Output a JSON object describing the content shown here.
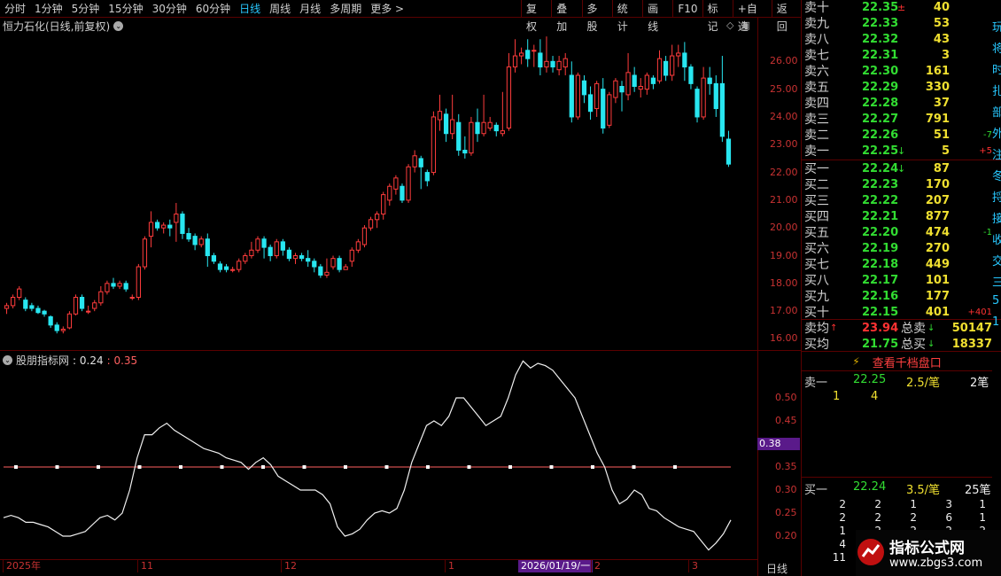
{
  "toolbar": {
    "periods": [
      "分时",
      "1分钟",
      "5分钟",
      "15分钟",
      "30分钟",
      "60分钟",
      "日线",
      "周线",
      "月线",
      "多周期",
      "更多 >"
    ],
    "active": "日线",
    "buttons": [
      "复权",
      "叠加",
      "多股",
      "统计",
      "画线",
      "F10",
      "标记",
      "+自选",
      "返回"
    ]
  },
  "chart_title": "恒力石化(日线,前复权)",
  "price_axis": {
    "ticks": [
      "26.00",
      "25.00",
      "24.00",
      "23.00",
      "22.00",
      "21.00",
      "20.00",
      "19.00",
      "18.00",
      "17.00",
      "16.00"
    ]
  },
  "indicator": {
    "name": "股朋指标网",
    "value1": ": 0.24",
    "value2": ": 0.35",
    "axis": [
      "0.50",
      "0.45",
      "0.40",
      "0.35",
      "0.30",
      "0.25",
      "0.20"
    ],
    "marker": "0.38"
  },
  "date_axis": {
    "ticks": [
      "2025年",
      "11",
      "12",
      "1",
      "2",
      "3"
    ],
    "cursor": "2026/01/19/一",
    "period": "日线"
  },
  "orderbook": {
    "asks": [
      {
        "label": "卖十",
        "price": "22.35",
        "arrow": "±",
        "vol": "40",
        "chg": ""
      },
      {
        "label": "卖九",
        "price": "22.33",
        "arrow": "",
        "vol": "53",
        "chg": ""
      },
      {
        "label": "卖八",
        "price": "22.32",
        "arrow": "",
        "vol": "43",
        "chg": ""
      },
      {
        "label": "卖七",
        "price": "22.31",
        "arrow": "",
        "vol": "3",
        "chg": ""
      },
      {
        "label": "卖六",
        "price": "22.30",
        "arrow": "",
        "vol": "161",
        "chg": ""
      },
      {
        "label": "卖五",
        "price": "22.29",
        "arrow": "",
        "vol": "330",
        "chg": ""
      },
      {
        "label": "卖四",
        "price": "22.28",
        "arrow": "",
        "vol": "37",
        "chg": ""
      },
      {
        "label": "卖三",
        "price": "22.27",
        "arrow": "",
        "vol": "791",
        "chg": ""
      },
      {
        "label": "卖二",
        "price": "22.26",
        "arrow": "",
        "vol": "51",
        "chg": "-7"
      },
      {
        "label": "卖一",
        "price": "22.25",
        "arrow": "↓",
        "vol": "5",
        "chg": "+5"
      }
    ],
    "bids": [
      {
        "label": "买一",
        "price": "22.24",
        "arrow": "↓",
        "vol": "87",
        "chg": ""
      },
      {
        "label": "买二",
        "price": "22.23",
        "arrow": "",
        "vol": "170",
        "chg": ""
      },
      {
        "label": "买三",
        "price": "22.22",
        "arrow": "",
        "vol": "207",
        "chg": ""
      },
      {
        "label": "买四",
        "price": "22.21",
        "arrow": "",
        "vol": "877",
        "chg": ""
      },
      {
        "label": "买五",
        "price": "22.20",
        "arrow": "",
        "vol": "474",
        "chg": "-1"
      },
      {
        "label": "买六",
        "price": "22.19",
        "arrow": "",
        "vol": "270",
        "chg": ""
      },
      {
        "label": "买七",
        "price": "22.18",
        "arrow": "",
        "vol": "449",
        "chg": ""
      },
      {
        "label": "买八",
        "price": "22.17",
        "arrow": "",
        "vol": "101",
        "chg": ""
      },
      {
        "label": "买九",
        "price": "22.16",
        "arrow": "",
        "vol": "177",
        "chg": ""
      },
      {
        "label": "买十",
        "price": "22.15",
        "arrow": "",
        "vol": "401",
        "chg": "+401"
      }
    ],
    "avg_ask": {
      "label": "卖均",
      "price": "23.94",
      "total_label": "总卖",
      "total": "50147"
    },
    "avg_bid": {
      "label": "买均",
      "price": "21.75",
      "total_label": "总买",
      "total": "18337"
    }
  },
  "side_fragments": [
    "玩",
    "将",
    "时",
    "扎",
    "部",
    "外",
    "注",
    "冬",
    "捋",
    "接",
    "收",
    "交",
    "三",
    "5",
    "1"
  ],
  "thousand_link": "查看千档盘口",
  "tick_ask": {
    "label": "卖一",
    "price": "22.25",
    "avg": "2.5/笔",
    "count": "2笔",
    "q1": "1",
    "q2": "4"
  },
  "tick_bid": {
    "label": "买一",
    "price": "22.24",
    "avg": "3.5/笔",
    "count": "25笔"
  },
  "bid_grid": [
    [
      "2",
      "2",
      "1",
      "3",
      "1"
    ],
    [
      "2",
      "2",
      "2",
      "6",
      "1"
    ],
    [
      "1",
      "2",
      "2",
      "2",
      "2"
    ],
    [
      "4",
      "",
      "",
      "",
      ""
    ],
    [
      "11",
      "",
      "",
      "",
      ""
    ]
  ],
  "watermark": {
    "line1": "指标公式网",
    "line2": "www.zbgs3.com"
  },
  "chart_data": {
    "type": "candlestick",
    "ylim": [
      15.6,
      27.0
    ],
    "candles": [
      [
        17.1,
        17.2,
        16.9,
        17.3
      ],
      [
        17.2,
        17.5,
        17.1,
        17.6
      ],
      [
        17.5,
        17.8,
        17.4,
        17.9
      ],
      [
        17.4,
        17.1,
        17.0,
        17.5
      ],
      [
        17.2,
        17.1,
        17.0,
        17.3
      ],
      [
        17.1,
        16.95,
        16.9,
        17.2
      ],
      [
        17.0,
        16.9,
        16.8,
        17.05
      ],
      [
        16.8,
        16.5,
        16.4,
        16.85
      ],
      [
        16.5,
        16.3,
        16.2,
        16.6
      ],
      [
        16.3,
        16.35,
        16.2,
        16.45
      ],
      [
        16.4,
        16.9,
        16.35,
        17.0
      ],
      [
        16.9,
        17.5,
        16.85,
        17.6
      ],
      [
        17.5,
        17.1,
        17.0,
        17.6
      ],
      [
        17.0,
        17.0,
        16.9,
        17.2
      ],
      [
        17.1,
        17.3,
        17.0,
        17.4
      ],
      [
        17.3,
        17.7,
        17.2,
        17.9
      ],
      [
        17.7,
        18.0,
        17.6,
        18.1
      ],
      [
        18.0,
        17.9,
        17.8,
        18.2
      ],
      [
        17.9,
        18.0,
        17.8,
        18.1
      ],
      [
        18.0,
        17.8,
        17.7,
        18.1
      ],
      [
        17.5,
        17.5,
        17.4,
        17.6
      ],
      [
        17.5,
        18.6,
        17.4,
        18.7
      ],
      [
        18.6,
        19.6,
        18.5,
        19.7
      ],
      [
        19.7,
        20.2,
        19.3,
        20.6
      ],
      [
        20.2,
        20.0,
        19.9,
        20.3
      ],
      [
        20.0,
        20.1,
        19.8,
        20.2
      ],
      [
        20.1,
        20.0,
        19.7,
        20.3
      ],
      [
        20.2,
        20.5,
        19.5,
        20.9
      ],
      [
        20.5,
        19.8,
        19.6,
        20.6
      ],
      [
        19.8,
        19.6,
        19.5,
        20.0
      ],
      [
        19.7,
        19.4,
        19.2,
        19.8
      ],
      [
        19.4,
        19.6,
        19.3,
        19.7
      ],
      [
        19.6,
        19.0,
        18.6,
        19.8
      ],
      [
        19.0,
        18.8,
        18.7,
        19.1
      ],
      [
        18.7,
        18.5,
        18.4,
        18.8
      ],
      [
        18.6,
        18.5,
        18.4,
        18.7
      ],
      [
        18.5,
        18.5,
        18.4,
        18.6
      ],
      [
        18.5,
        18.8,
        18.4,
        18.9
      ],
      [
        18.8,
        19.0,
        18.7,
        19.1
      ],
      [
        19.0,
        19.2,
        18.9,
        19.5
      ],
      [
        19.2,
        19.6,
        19.1,
        19.7
      ],
      [
        19.6,
        19.3,
        18.9,
        19.7
      ],
      [
        19.3,
        19.0,
        18.8,
        19.4
      ],
      [
        19.0,
        19.5,
        18.9,
        19.6
      ],
      [
        19.5,
        19.2,
        19.0,
        19.6
      ],
      [
        19.2,
        18.9,
        18.8,
        19.3
      ],
      [
        18.9,
        19.0,
        18.7,
        19.1
      ],
      [
        19.0,
        18.9,
        18.8,
        19.1
      ],
      [
        18.9,
        18.8,
        18.6,
        19.2
      ],
      [
        18.8,
        18.6,
        18.4,
        18.9
      ],
      [
        18.6,
        18.3,
        18.2,
        18.7
      ],
      [
        18.3,
        18.4,
        18.2,
        18.9
      ],
      [
        18.6,
        18.9,
        18.5,
        19.0
      ],
      [
        18.9,
        18.5,
        18.4,
        19.0
      ],
      [
        18.5,
        18.6,
        18.5,
        18.7
      ],
      [
        18.8,
        19.2,
        18.6,
        19.3
      ],
      [
        19.2,
        19.5,
        19.1,
        19.6
      ],
      [
        19.4,
        20.0,
        19.3,
        20.1
      ],
      [
        20.0,
        20.3,
        19.9,
        20.4
      ],
      [
        20.3,
        20.5,
        20.0,
        20.6
      ],
      [
        20.5,
        21.2,
        20.3,
        21.3
      ],
      [
        21.0,
        21.5,
        20.8,
        21.6
      ],
      [
        21.4,
        21.8,
        21.2,
        21.9
      ],
      [
        21.5,
        21.0,
        20.9,
        21.6
      ],
      [
        21.0,
        22.2,
        20.9,
        22.3
      ],
      [
        22.2,
        22.6,
        22.0,
        22.8
      ],
      [
        22.5,
        22.2,
        21.4,
        22.6
      ],
      [
        22.0,
        21.7,
        21.5,
        22.1
      ],
      [
        22.0,
        24.0,
        21.9,
        24.2
      ],
      [
        23.9,
        24.2,
        23.5,
        24.8
      ],
      [
        24.1,
        23.4,
        23.1,
        24.3
      ],
      [
        23.4,
        23.9,
        23.2,
        24.8
      ],
      [
        23.8,
        22.8,
        22.6,
        24.1
      ],
      [
        22.8,
        22.7,
        22.5,
        23.3
      ],
      [
        22.7,
        23.8,
        22.6,
        24.0
      ],
      [
        23.8,
        23.4,
        23.1,
        24.3
      ],
      [
        23.4,
        23.8,
        23.3,
        24.8
      ],
      [
        23.6,
        23.8,
        23.5,
        24.0
      ],
      [
        23.7,
        23.5,
        23.3,
        23.8
      ],
      [
        23.4,
        23.5,
        23.3,
        24.9
      ],
      [
        23.6,
        25.8,
        23.5,
        26.3
      ],
      [
        25.8,
        26.2,
        25.6,
        26.8
      ],
      [
        26.2,
        26.3,
        25.9,
        26.5
      ],
      [
        26.4,
        26.1,
        25.8,
        26.8
      ],
      [
        26.4,
        26.4,
        25.8,
        26.6
      ],
      [
        26.3,
        25.8,
        25.5,
        26.8
      ],
      [
        25.8,
        26.0,
        25.6,
        26.9
      ],
      [
        26.0,
        25.8,
        25.6,
        26.2
      ],
      [
        25.7,
        26.0,
        25.5,
        26.2
      ],
      [
        25.8,
        26.1,
        25.5,
        26.3
      ],
      [
        25.5,
        24.0,
        23.8,
        26.0
      ],
      [
        24.0,
        25.5,
        23.9,
        25.6
      ],
      [
        25.3,
        24.8,
        24.5,
        25.5
      ],
      [
        24.8,
        24.2,
        23.9,
        25.1
      ],
      [
        24.3,
        25.2,
        24.0,
        25.3
      ],
      [
        25.0,
        23.6,
        23.4,
        25.4
      ],
      [
        23.7,
        24.8,
        23.6,
        24.9
      ],
      [
        24.7,
        25.3,
        24.5,
        25.4
      ],
      [
        25.1,
        24.9,
        24.2,
        25.3
      ],
      [
        24.8,
        25.6,
        24.6,
        26.3
      ],
      [
        25.5,
        25.1,
        24.9,
        25.8
      ],
      [
        25.0,
        25.1,
        24.7,
        25.4
      ],
      [
        25.0,
        25.5,
        24.8,
        25.6
      ],
      [
        25.4,
        25.2,
        25.0,
        25.5
      ],
      [
        25.3,
        26.1,
        25.2,
        26.4
      ],
      [
        26.0,
        25.5,
        25.3,
        26.2
      ],
      [
        25.5,
        26.2,
        25.3,
        26.6
      ],
      [
        26.2,
        26.3,
        25.8,
        26.6
      ],
      [
        26.3,
        25.8,
        25.3,
        26.7
      ],
      [
        25.8,
        25.2,
        25.0,
        25.9
      ],
      [
        25.0,
        24.0,
        23.8,
        25.1
      ],
      [
        24.0,
        25.4,
        23.9,
        25.8
      ],
      [
        25.4,
        25.2,
        24.8,
        25.8
      ],
      [
        25.2,
        24.3,
        24.0,
        25.5
      ],
      [
        25.2,
        23.3,
        23.1,
        26.2
      ],
      [
        23.2,
        22.3,
        22.2,
        23.5
      ]
    ],
    "indicator": [
      0.24,
      0.245,
      0.24,
      0.23,
      0.23,
      0.225,
      0.22,
      0.21,
      0.2,
      0.2,
      0.205,
      0.21,
      0.225,
      0.24,
      0.245,
      0.235,
      0.25,
      0.3,
      0.37,
      0.42,
      0.42,
      0.435,
      0.445,
      0.43,
      0.42,
      0.41,
      0.4,
      0.39,
      0.385,
      0.38,
      0.37,
      0.365,
      0.36,
      0.345,
      0.36,
      0.37,
      0.355,
      0.33,
      0.32,
      0.31,
      0.3,
      0.3,
      0.3,
      0.29,
      0.27,
      0.22,
      0.2,
      0.205,
      0.215,
      0.235,
      0.25,
      0.255,
      0.25,
      0.26,
      0.3,
      0.36,
      0.4,
      0.44,
      0.45,
      0.44,
      0.46,
      0.5,
      0.5,
      0.48,
      0.46,
      0.44,
      0.45,
      0.46,
      0.5,
      0.55,
      0.58,
      0.565,
      0.575,
      0.57,
      0.56,
      0.54,
      0.52,
      0.5,
      0.46,
      0.42,
      0.38,
      0.35,
      0.3,
      0.27,
      0.28,
      0.3,
      0.29,
      0.26,
      0.255,
      0.24,
      0.23,
      0.22,
      0.215,
      0.21,
      0.19,
      0.17,
      0.185,
      0.205,
      0.235
    ],
    "reference_level": 0.35
  }
}
